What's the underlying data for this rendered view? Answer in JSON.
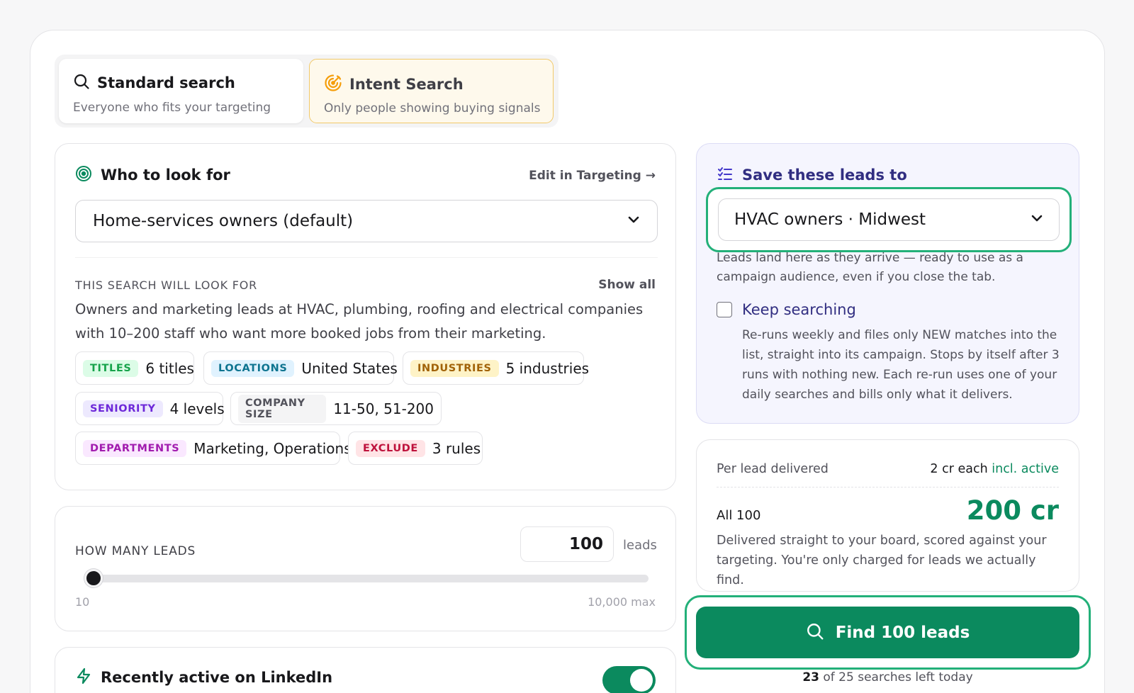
{
  "mode_toggle": {
    "standard": {
      "title": "Standard search",
      "subtitle": "Everyone who fits your targeting"
    },
    "intent": {
      "title": "Intent Search",
      "subtitle": "Only people showing buying signals"
    }
  },
  "who": {
    "title": "Who to look for",
    "edit_link": "Edit in Targeting →",
    "selected_audience": "Home-services owners (default)",
    "section_caption": "THIS SEARCH WILL LOOK FOR",
    "show_all": "Show all",
    "description": "Owners and marketing leads at HVAC, plumbing, roofing and electrical companies with 10–200 staff who want more booked jobs from their marketing.",
    "chips": [
      {
        "tag": "TITLES",
        "value": "6 titles",
        "color": "#16a34a",
        "bg": "#dcfce7"
      },
      {
        "tag": "LOCATIONS",
        "value": "United States",
        "color": "#0e7490",
        "bg": "#e0f2fe"
      },
      {
        "tag": "INDUSTRIES",
        "value": "5 industries",
        "color": "#a16207",
        "bg": "#fef3c7"
      },
      {
        "tag": "SENIORITY",
        "value": "4 levels",
        "color": "#6d28d9",
        "bg": "#ede9fe"
      },
      {
        "tag": "COMPANY SIZE",
        "value": "11-50, 51-200",
        "color": "#52525b",
        "bg": "#f4f4f5"
      },
      {
        "tag": "DEPARTMENTS",
        "value": "Marketing, Operations",
        "color": "#a21caf",
        "bg": "#fae8ff"
      },
      {
        "tag": "EXCLUDE",
        "value": "3 rules",
        "color": "#be123c",
        "bg": "#ffe4e6"
      }
    ]
  },
  "how_many": {
    "caption": "HOW MANY LEADS",
    "value": "100",
    "unit": "leads",
    "min_label": "10",
    "max_label": "10,000 max",
    "slider_fraction": 0.009
  },
  "recent": {
    "title": "Recently active on LinkedIn",
    "enabled": true
  },
  "save": {
    "title": "Save these leads to",
    "selected_list": "HVAC owners · Midwest",
    "hint": "Leads land here as they arrive — ready to use as a campaign audience, even if you close the tab.",
    "keep_label": "Keep searching",
    "keep_checked": false,
    "keep_desc": "Re-runs weekly and files only NEW matches into the list, straight into its campaign. Stops by itself after 3 runs with nothing new. Each re-run uses one of your daily searches and bills only what it delivers."
  },
  "cost": {
    "per_lead_label": "Per lead delivered",
    "per_lead_value": "2 cr each",
    "per_lead_note": "incl. active",
    "all_label": "All 100",
    "total": "200 cr",
    "description": "Delivered straight to your board, scored against your targeting. You're only charged for leads we actually find."
  },
  "cta": {
    "label": "Find 100 leads",
    "searches_used": "23",
    "searches_rest": "of 25 searches left today"
  },
  "colors": {
    "accent_green": "#0b8a5e",
    "ring_green": "#23b079",
    "intent_amber": "#f59e0b",
    "indigo_text": "#312e81"
  }
}
